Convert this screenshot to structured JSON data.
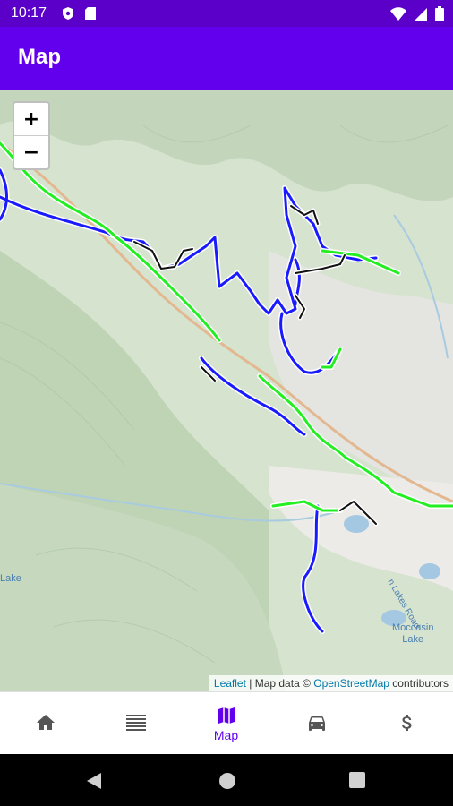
{
  "status": {
    "time": "10:17"
  },
  "appbar": {
    "title": "Map"
  },
  "map": {
    "zoom_in": "+",
    "zoom_out": "−",
    "attribution": {
      "leaflet": "Leaflet",
      "separator": " | Map data © ",
      "osm": "OpenStreetMap",
      "suffix": " contributors"
    },
    "labels": {
      "lake_left": "Lake",
      "lakes_road": "n Lakes Road",
      "moccasin_line1": "Moccasin",
      "moccasin_line2": "Lake"
    },
    "trail_colors": {
      "primary": "#1a1aff",
      "secondary": "#22ee22",
      "tertiary": "#111111"
    }
  },
  "nav": {
    "items": [
      {
        "icon": "home-icon",
        "label": ""
      },
      {
        "icon": "list-icon",
        "label": ""
      },
      {
        "icon": "map-icon",
        "label": "Map"
      },
      {
        "icon": "car-icon",
        "label": ""
      },
      {
        "icon": "dollar-icon",
        "label": ""
      }
    ],
    "active_color": "#6200ee"
  }
}
